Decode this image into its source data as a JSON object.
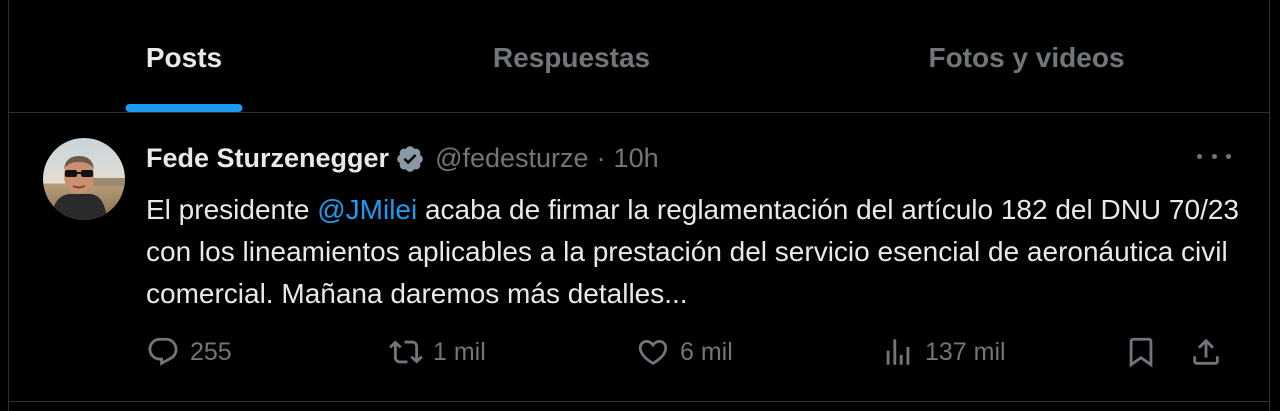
{
  "tabs": [
    {
      "label": "Posts",
      "active": true
    },
    {
      "label": "Respuestas",
      "active": false
    },
    {
      "label": "Fotos y videos",
      "active": false
    }
  ],
  "post": {
    "author_name": "Fede Sturzenegger",
    "handle": "@fedesturze",
    "separator": "·",
    "time": "10h",
    "text_before": "El presidente ",
    "mention": "@JMilei",
    "text_after": " acaba de firmar la reglamentación del artículo 182 del DNU 70/23 con los lineamientos aplicables a la prestación del servicio esencial de aeronáutica civil comercial. Mañana daremos más detalles...",
    "actions": {
      "replies": "255",
      "reposts": "1 mil",
      "likes": "6 mil",
      "views": "137 mil"
    }
  },
  "icons": {
    "verified": "verified-badge-icon",
    "more": "more-icon",
    "reply": "reply-icon",
    "repost": "repost-icon",
    "like": "heart-icon",
    "views": "views-icon",
    "bookmark": "bookmark-icon",
    "share": "share-icon"
  },
  "colors": {
    "background": "#000000",
    "accent": "#1d9bf0",
    "muted": "#71767b",
    "text": "#e7e9ea",
    "border": "#2f3336"
  }
}
